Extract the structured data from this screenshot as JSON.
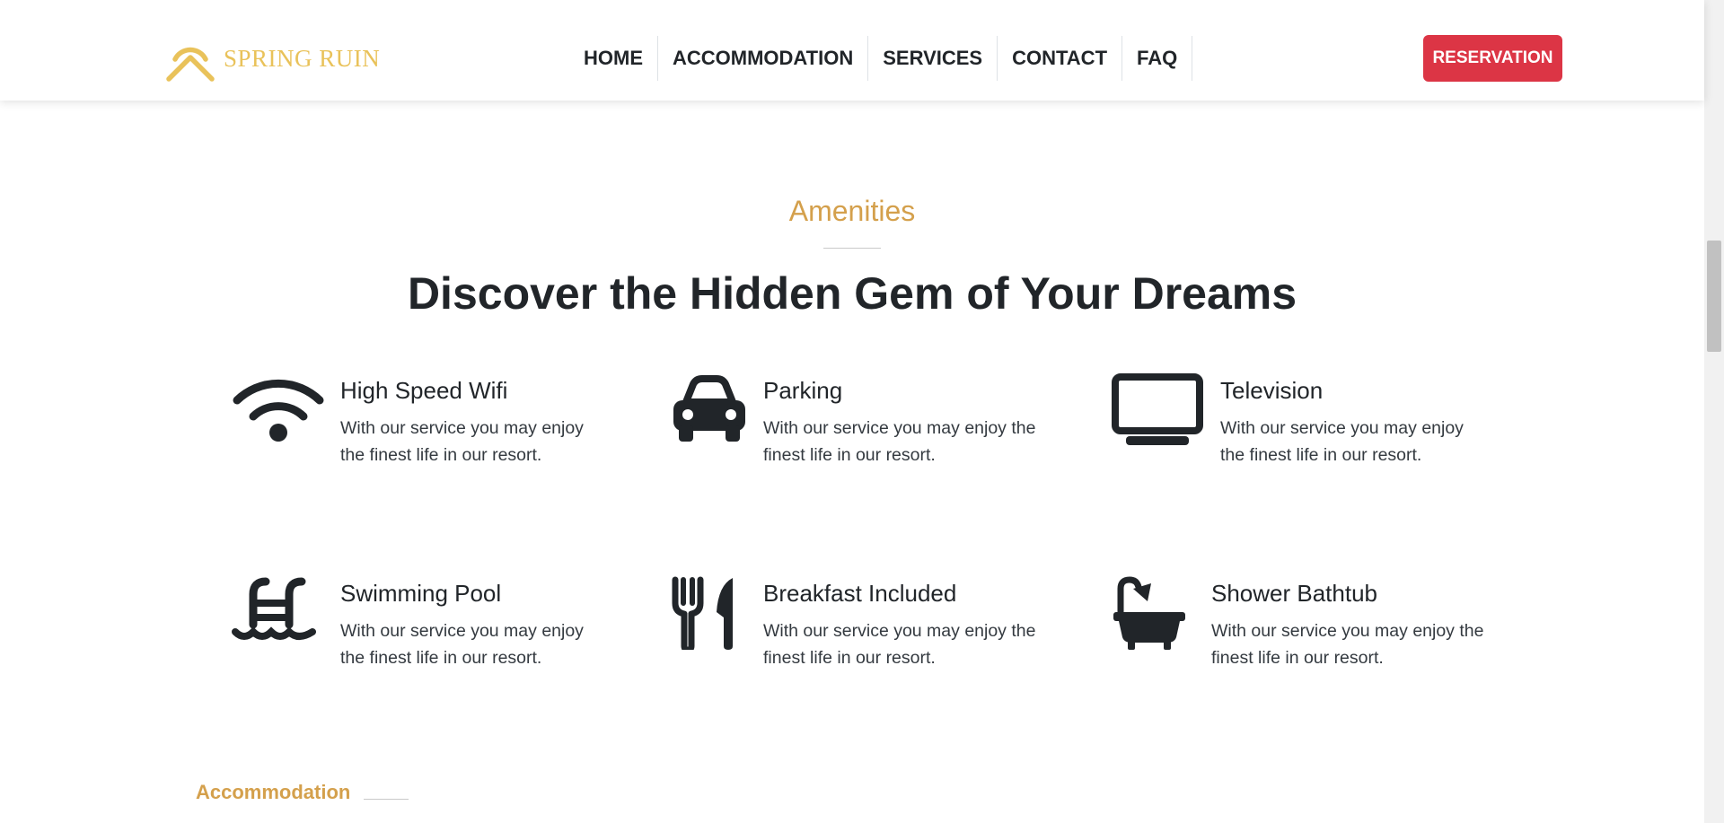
{
  "brand": {
    "name": "SPRING RUIN",
    "logo_color": "#e9c25a"
  },
  "nav": {
    "items": [
      {
        "label": "HOME"
      },
      {
        "label": "ACCOMMODATION"
      },
      {
        "label": "SERVICES"
      },
      {
        "label": "CONTACT"
      },
      {
        "label": "FAQ"
      }
    ],
    "reservation_label": "RESERVATION"
  },
  "amenities": {
    "eyebrow": "Amenities",
    "headline": "Discover the Hidden Gem of Your Dreams",
    "items": [
      {
        "title": "High Speed Wifi",
        "icon": "wifi-icon",
        "description": "With our service you may enjoy the finest life in our resort."
      },
      {
        "title": "Parking",
        "icon": "car-icon",
        "description": "With our service you may enjoy the finest life in our resort."
      },
      {
        "title": "Television",
        "icon": "tv-icon",
        "description": "With our service you may enjoy the finest life in our resort."
      },
      {
        "title": "Swimming Pool",
        "icon": "swimming-pool-icon",
        "description": "With our service you may enjoy the finest life in our resort."
      },
      {
        "title": "Breakfast Included",
        "icon": "utensils-icon",
        "description": "With our service you may enjoy the finest life in our resort."
      },
      {
        "title": "Shower Bathtub",
        "icon": "bathtub-icon",
        "description": "With our service you may enjoy the finest life in our resort."
      }
    ]
  },
  "next_section": {
    "eyebrow": "Accommodation"
  },
  "colors": {
    "accent": "#d4a04c",
    "reservation": "#dc3545",
    "text": "#212529"
  }
}
